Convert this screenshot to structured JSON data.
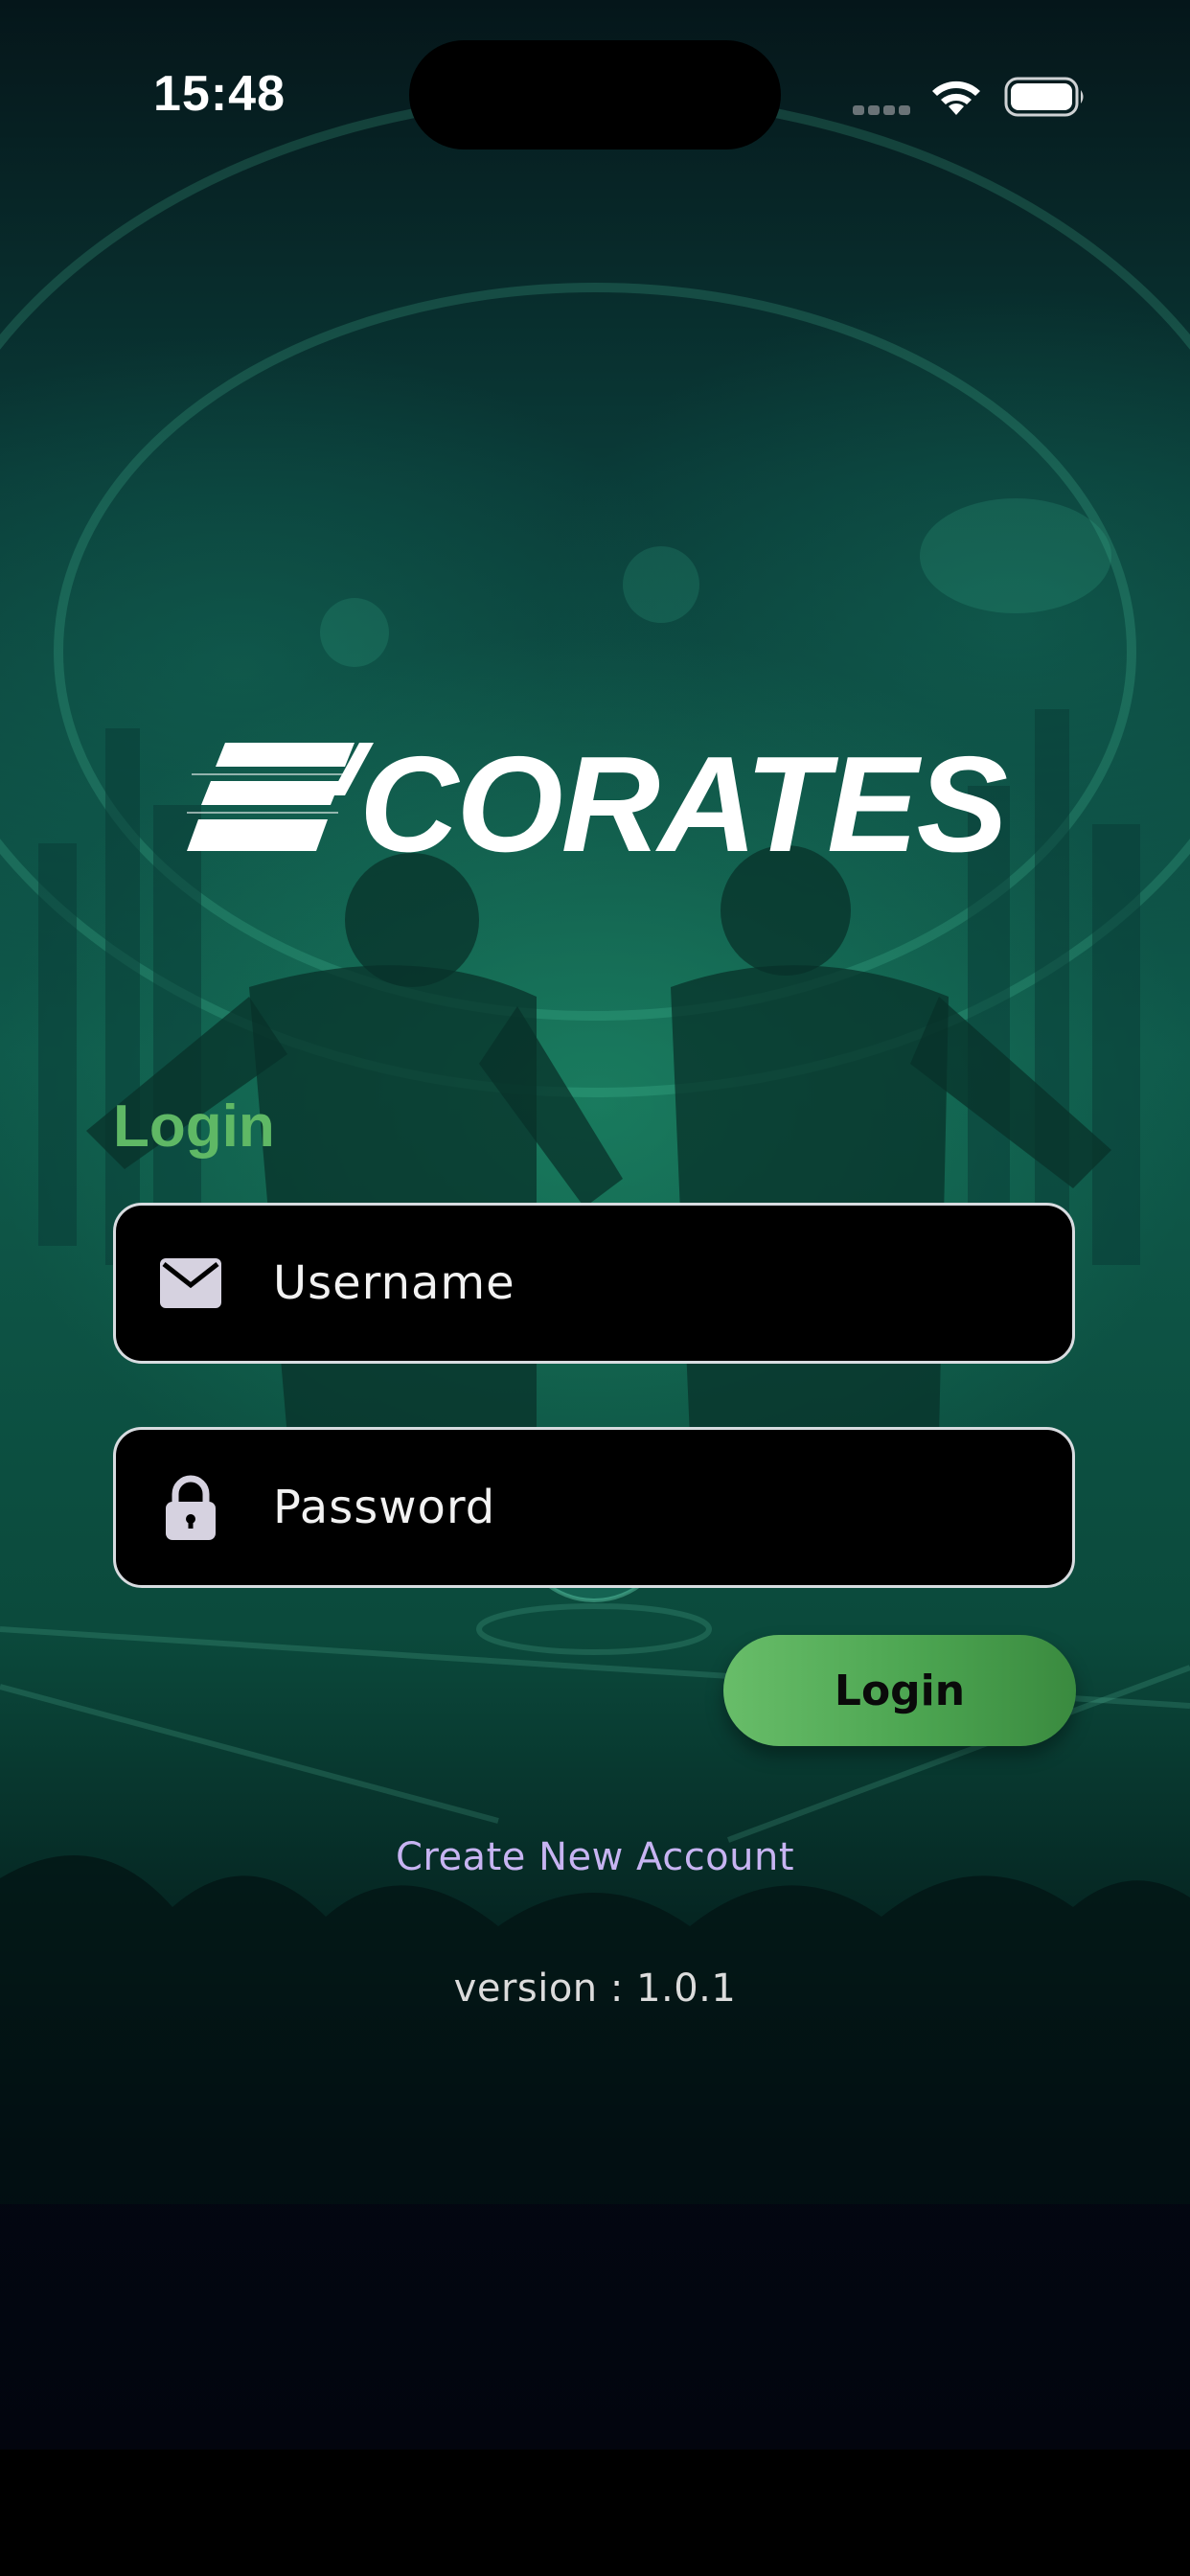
{
  "status_bar": {
    "time": "15:48"
  },
  "brand": {
    "logo_text": "SCORATES"
  },
  "login_form": {
    "heading": "Login",
    "username_placeholder": "Username",
    "password_placeholder": "Password",
    "username_icon": "envelope-icon",
    "password_icon": "lock-icon",
    "submit_label": "Login"
  },
  "footer": {
    "create_account_label": "Create New Account",
    "version_text": "version : 1.0.1"
  },
  "colors": {
    "accent_green": "#5fb865",
    "link_purple": "#c7b4f2",
    "field_background": "#000000",
    "field_border": "#d8dce0"
  }
}
